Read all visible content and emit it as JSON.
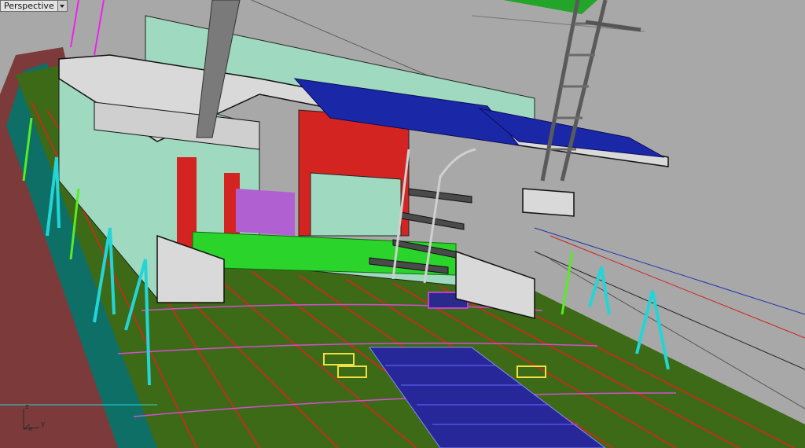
{
  "viewport": {
    "title": "Perspective",
    "menu_icon": "triangle-down-icon",
    "background_color": "#a8a8a8"
  },
  "axes": {
    "z_label": "z",
    "x_label": "x",
    "y_label": "y",
    "icon": "axis-gizmo-icon"
  },
  "model_colors": {
    "deck": "#3d6a17",
    "deck_lines": "#e0201c",
    "hull": "#0e6f66",
    "cabin": "#9fd9bf",
    "cabin_red": "#d42422",
    "roof": "#d9d9d9",
    "solar": "#1a28a8",
    "railing": "#22d6d8",
    "mast": "#7a7a7a",
    "sail": "#23a52a",
    "hatch": "#27279a"
  }
}
